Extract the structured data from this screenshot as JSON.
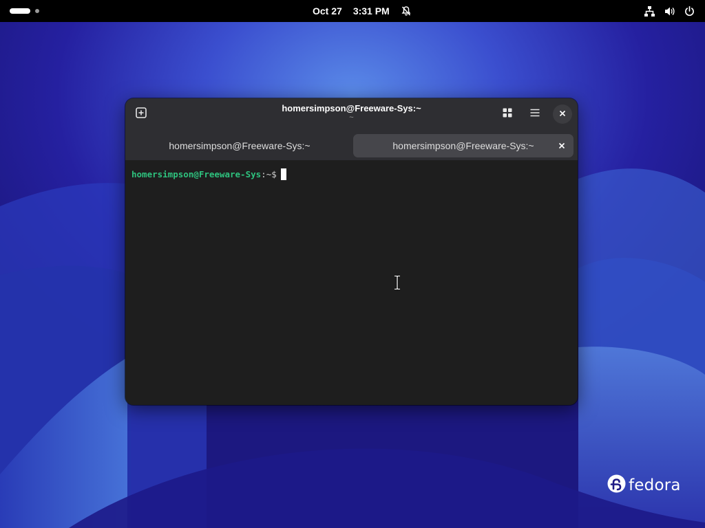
{
  "topbar": {
    "date": "Oct 27",
    "time": "3:31 PM",
    "icons": [
      "notifications-muted-icon",
      "network-wired-icon",
      "volume-icon",
      "power-icon"
    ]
  },
  "window": {
    "title": "homersimpson@Freeware-Sys:~",
    "subtitle": "~",
    "buttons": {
      "new_tab": "new-tab-icon",
      "overview": "tab-overview-grid-icon",
      "menu": "hamburger-menu-icon",
      "close": "close-icon"
    },
    "tabs": [
      {
        "label": "homersimpson@Freeware-Sys:~",
        "active": false
      },
      {
        "label": "homersimpson@Freeware-Sys:~",
        "active": true
      }
    ]
  },
  "terminal": {
    "user_host": "homersimpson@Freeware-Sys",
    "separator": ":",
    "path": "~",
    "sigil": "$"
  },
  "brand": {
    "logo_text": "fedora"
  },
  "colors": {
    "prompt_user": "#2ec27e",
    "headerbar": "#2e2e32",
    "terminal_bg": "#1e1e1e",
    "wallpaper": "#1e1a85"
  }
}
